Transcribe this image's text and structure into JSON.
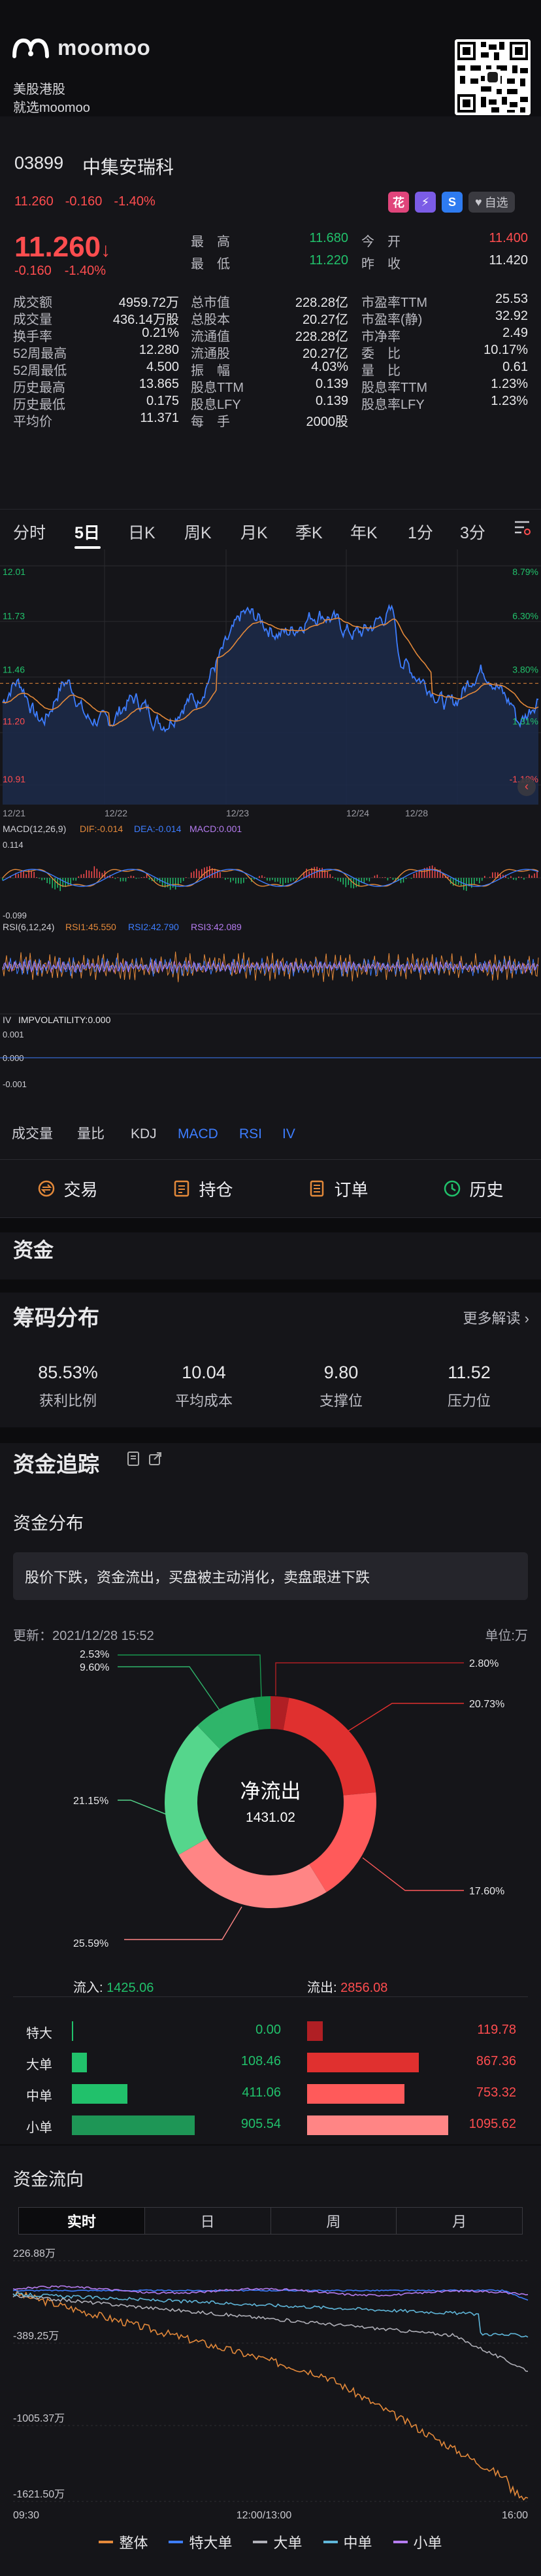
{
  "header": {
    "brand": "moomoo",
    "line1": "美股港股",
    "line2": "就选moomoo"
  },
  "stock": {
    "code": "03899",
    "name": "中集安瑞科",
    "price_small": "11.260",
    "chg_small": "-0.160",
    "pct_small": "-1.40%",
    "price": "11.260",
    "arrow": "↓",
    "chg": "-0.160",
    "pct": "-1.40%",
    "icons": [
      "花",
      "⚡",
      "S"
    ],
    "watch_label": "自选"
  },
  "quote": {
    "high": {
      "label": "最　高",
      "value": "11.680"
    },
    "low": {
      "label": "最　低",
      "value": "11.220"
    },
    "open": {
      "label": "今　开",
      "value": "11.400"
    },
    "prev": {
      "label": "昨　收",
      "value": "11.420"
    },
    "rows": [
      {
        "l1": "成交额",
        "v1": "4959.72万",
        "l2": "总市值",
        "v2": "228.28亿",
        "l3": "市盈率TTM",
        "v3": "25.53"
      },
      {
        "l1": "成交量",
        "v1": "436.14万股",
        "l2": "总股本",
        "v2": "20.27亿",
        "l3": "市盈率(静)",
        "v3": "32.92"
      },
      {
        "l1": "换手率",
        "v1": "0.21%",
        "l2": "流通值",
        "v2": "228.28亿",
        "l3": "市净率",
        "v3": "2.49"
      },
      {
        "l1": "52周最高",
        "v1": "12.280",
        "l2": "流通股",
        "v2": "20.27亿",
        "l3": "委　比",
        "v3": "10.17%"
      },
      {
        "l1": "52周最低",
        "v1": "4.500",
        "l2": "振　幅",
        "v2": "4.03%",
        "l3": "量　比",
        "v3": "0.61"
      },
      {
        "l1": "历史最高",
        "v1": "13.865",
        "l2": "股息TTM",
        "v2": "0.139",
        "l3": "股息率TTM",
        "v3": "1.23%"
      },
      {
        "l1": "历史最低",
        "v1": "0.175",
        "l2": "股息LFY",
        "v2": "0.139",
        "l3": "股息率LFY",
        "v3": "1.23%"
      },
      {
        "l1": "平均价",
        "v1": "11.371",
        "l2": "每　手",
        "v2": "2000股",
        "l3": "",
        "v3": ""
      }
    ]
  },
  "period_tabs": [
    "分时",
    "5日",
    "日K",
    "周K",
    "月K",
    "季K",
    "年K",
    "1分",
    "3分"
  ],
  "active_period": "5日",
  "kchart": {
    "y_left": [
      "12.01",
      "11.73",
      "11.46",
      "11.20",
      "10.91"
    ],
    "y_right": [
      "8.79%",
      "6.30%",
      "3.80%",
      "1.31%",
      "-1.18%"
    ],
    "x": [
      "12/21",
      "12/22",
      "12/23",
      "12/24",
      "12/28"
    ],
    "macd": {
      "label": "MACD(12,26,9)",
      "dif": "DIF:-0.014",
      "dea": "DEA:-0.014",
      "macd": "MACD:0.001",
      "top": "0.114",
      "bot": "-0.099"
    },
    "rsi": {
      "label": "RSI(6,12,24)",
      "r1": "RSI1:45.550",
      "r2": "RSI2:42.790",
      "r3": "RSI3:42.089"
    },
    "iv": {
      "label": "IV",
      "v": "IMPVOLATILITY:0.000",
      "t1": "0.001",
      "t2": "0.000",
      "t3": "-0.001"
    },
    "indicators": [
      "成交量",
      "量比",
      "KDJ",
      "MACD",
      "RSI",
      "IV"
    ]
  },
  "bottom_nav": [
    "交易",
    "持仓",
    "订单",
    "历史"
  ],
  "fund_title": "资金",
  "chip": {
    "title": "筹码分布",
    "more": "更多解读",
    "stats": [
      {
        "v": "85.53%",
        "l": "获利比例"
      },
      {
        "v": "10.04",
        "l": "平均成本"
      },
      {
        "v": "9.80",
        "l": "支撑位"
      },
      {
        "v": "11.52",
        "l": "压力位"
      }
    ]
  },
  "tracking": {
    "title": "资金追踪",
    "dist_title": "资金分布",
    "note": "股价下跌，资金流出，买盘被主动消化，卖盘跟进下跌",
    "updated": "更新：2021/12/28 15:52",
    "unit": "单位:万",
    "donut": {
      "center_label": "净流出",
      "center_value": "1431.02",
      "labels": [
        "2.80%",
        "20.73%",
        "17.60%",
        "25.59%",
        "21.15%",
        "9.60%",
        "2.53%"
      ],
      "slices": [
        2.8,
        20.73,
        17.6,
        25.59,
        21.15,
        9.6,
        2.53
      ]
    },
    "inflow_label": "流入:",
    "inflow": "1425.06",
    "outflow_label": "流出:",
    "outflow": "2856.08",
    "rows": [
      {
        "name": "特大",
        "in": "0.00",
        "out": "119.78"
      },
      {
        "name": "大单",
        "in": "108.46",
        "out": "867.36"
      },
      {
        "name": "中单",
        "in": "411.06",
        "out": "753.32"
      },
      {
        "name": "小单",
        "in": "905.54",
        "out": "1095.62"
      }
    ]
  },
  "flow": {
    "title": "资金流向",
    "tabs": [
      "实时",
      "日",
      "周",
      "月"
    ],
    "y": [
      "226.88万",
      "-389.25万",
      "-1005.37万",
      "-1621.50万"
    ],
    "x": [
      "09:30",
      "12:00/13:00",
      "16:00"
    ],
    "legend": [
      "整体",
      "特大单",
      "大单",
      "中单",
      "小单"
    ]
  },
  "colors": {
    "red": "#ff4d4f",
    "green": "#21c16b",
    "blue": "#3d7dff",
    "orange": "#e4893a",
    "purple": "#b57cf0"
  }
}
